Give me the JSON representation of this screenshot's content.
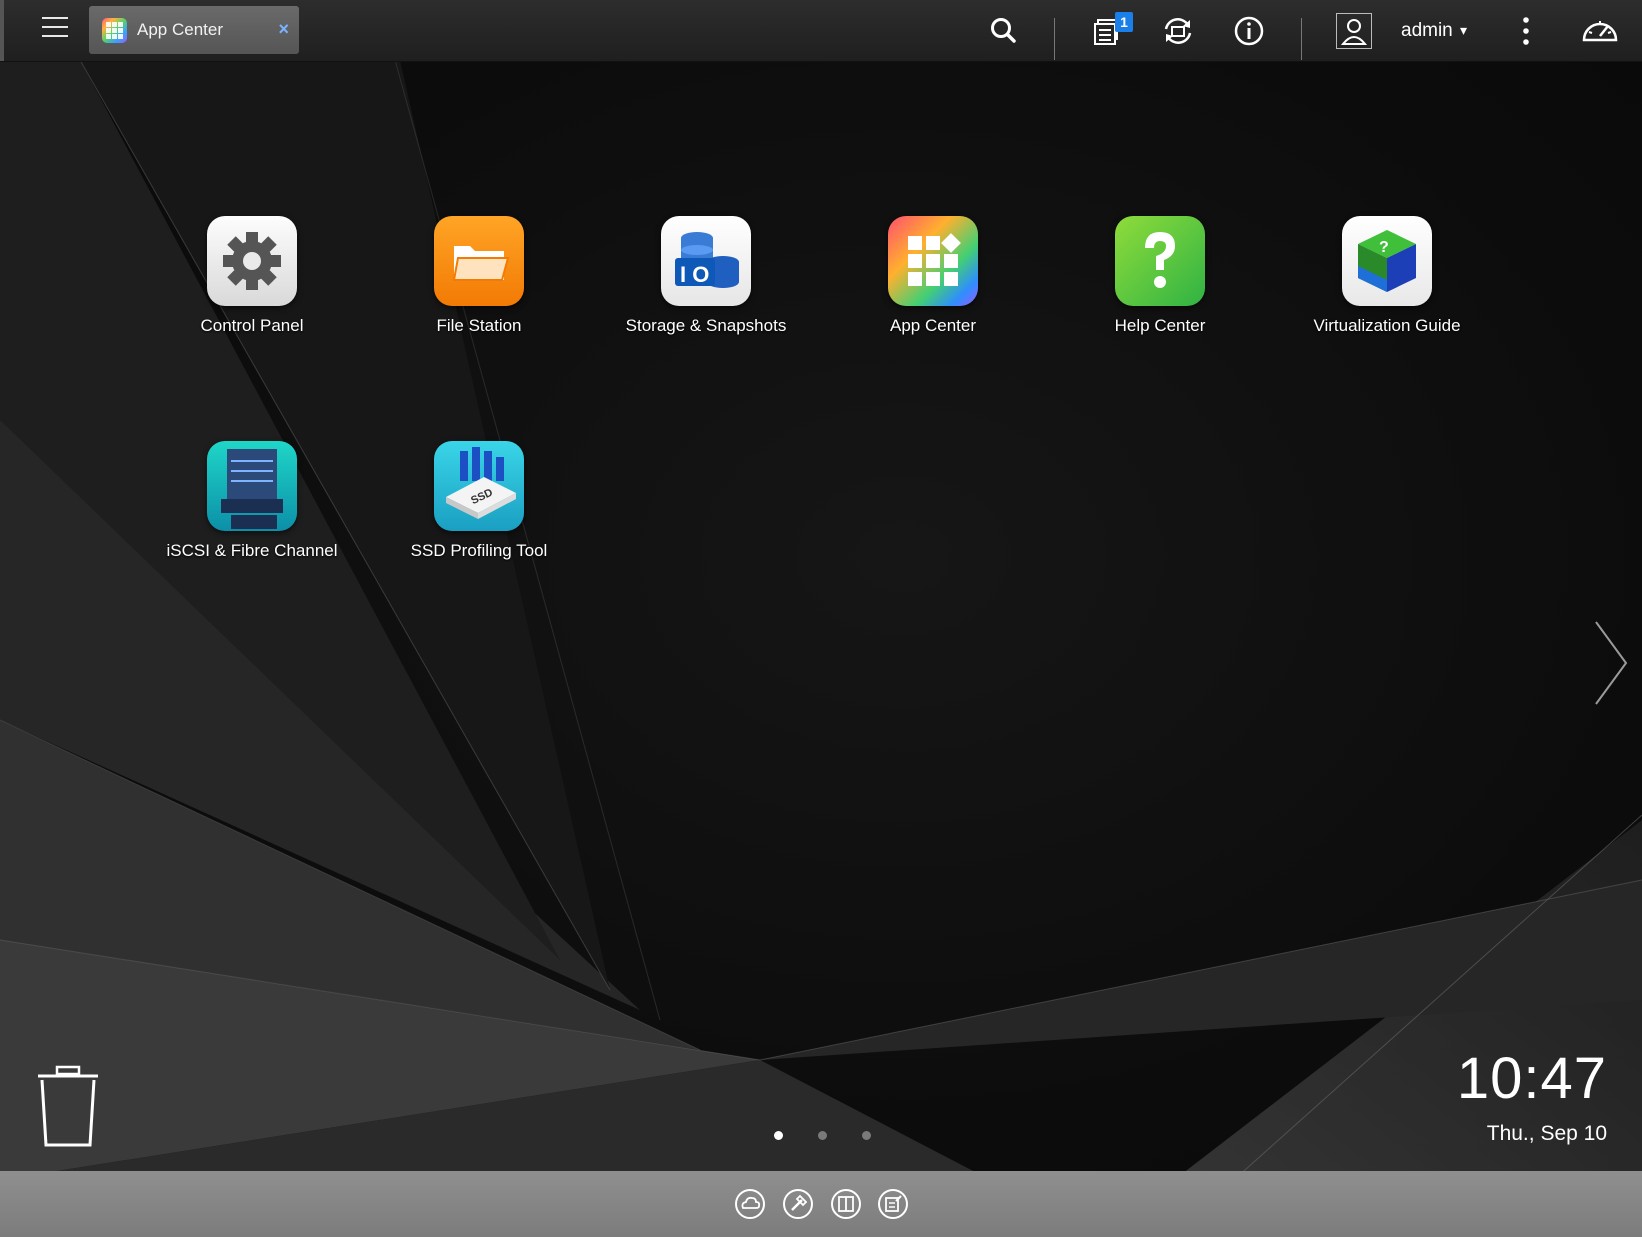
{
  "topbar": {
    "tab": {
      "label": "App Center",
      "close_symbol": "×",
      "icon": "app-center-icon"
    },
    "notification_badge": "1",
    "username": "admin",
    "icons": [
      "menu-icon",
      "search-icon",
      "tasks-icon",
      "sync-icon",
      "info-icon",
      "user-icon",
      "more-icon",
      "dashboard-icon"
    ]
  },
  "apps": [
    {
      "label": "Control Panel",
      "icon": "control-panel-icon"
    },
    {
      "label": "File Station",
      "icon": "file-station-icon"
    },
    {
      "label": "Storage & Snapshots",
      "icon": "storage-snapshots-icon"
    },
    {
      "label": "App Center",
      "icon": "app-center-icon"
    },
    {
      "label": "Help Center",
      "icon": "help-center-icon"
    },
    {
      "label": "Virtualization Guide",
      "icon": "virtualization-guide-icon"
    },
    {
      "label": "iSCSI & Fibre Channel",
      "icon": "iscsi-icon"
    },
    {
      "label": "SSD Profiling Tool",
      "icon": "ssd-profiling-icon"
    }
  ],
  "pagination": {
    "pages": 3,
    "current": 1
  },
  "clock": {
    "time": "10:47",
    "date": "Thu., Sep 10"
  },
  "dock": {
    "icons": [
      "cloud-icon",
      "tools-icon",
      "book-icon",
      "notes-icon"
    ]
  },
  "colors": {
    "accent": "#1a7fe8",
    "dock": "#858585",
    "topbar": "#262626"
  }
}
